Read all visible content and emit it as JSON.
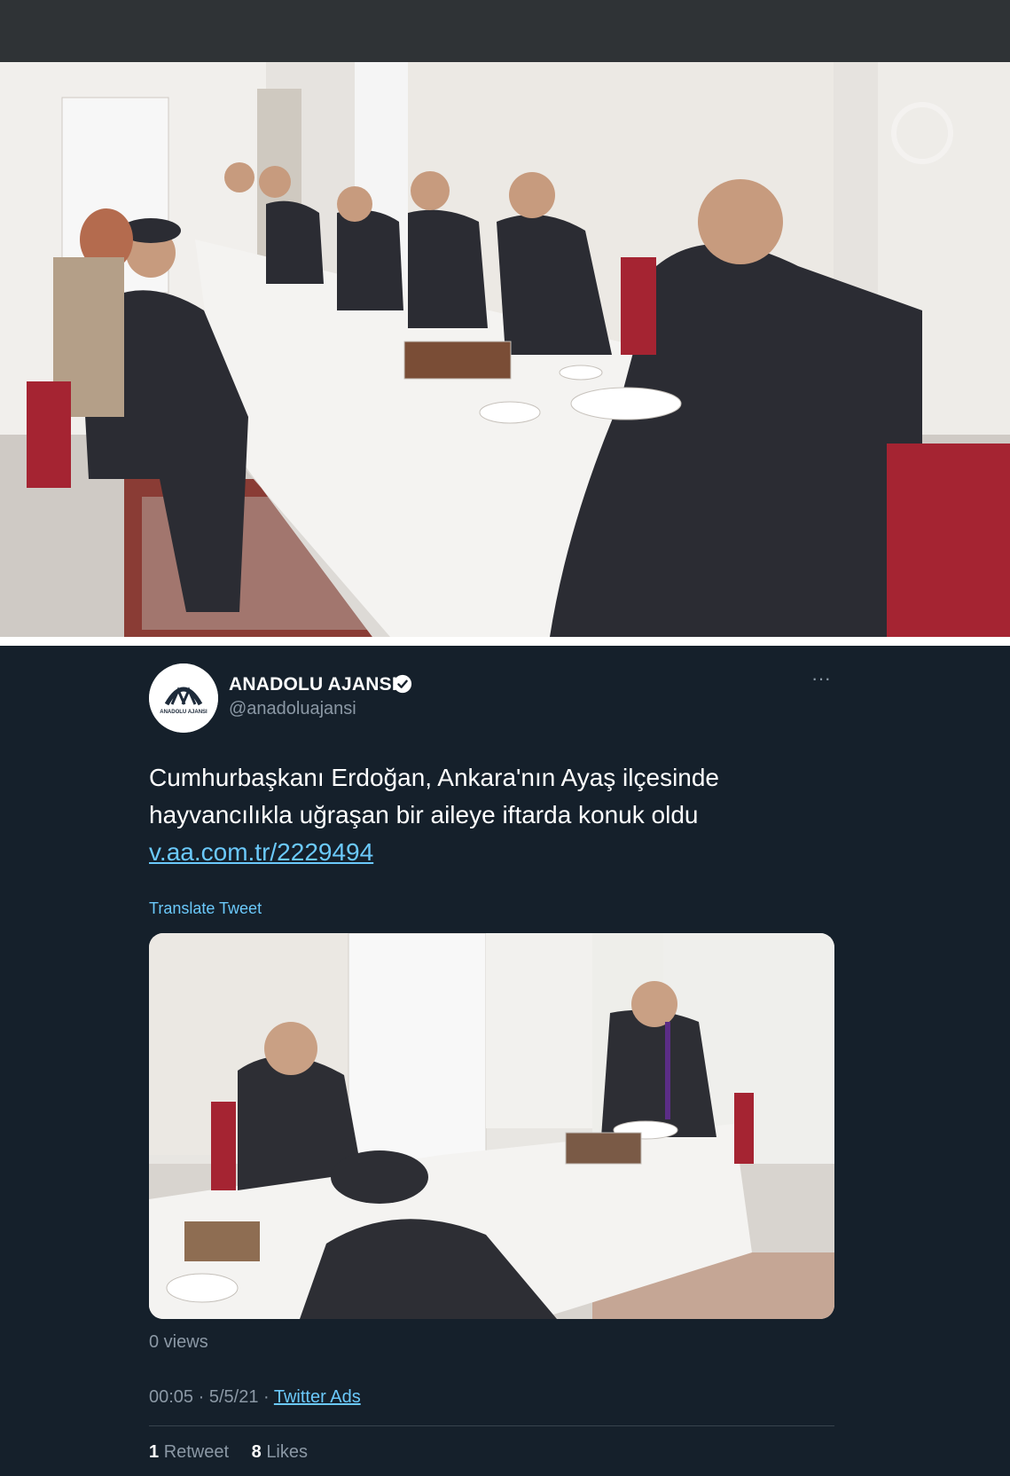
{
  "tweet": {
    "author_name": "ANADOLU AJANSI",
    "handle": "@anadoluajansi",
    "avatar_text": "ANADOLU AJANSI",
    "text_main": "Cumhurbaşkanı Erdoğan, Ankara'nın Ayaş ilçesinde hayvancılıkla uğraşan bir aileye iftarda konuk oldu ",
    "link_text": "v.aa.com.tr/2229494",
    "translate_label": "Translate Tweet",
    "views": "0 views",
    "time": "00:05",
    "date": "5/5/21",
    "source": "Twitter Ads",
    "retweets_count": "1",
    "retweets_label": "Retweet",
    "likes_count": "8",
    "likes_label": "Likes",
    "more_label": "···"
  },
  "colors": {
    "background": "#15202b",
    "link": "#6bc9fb",
    "secondary_text": "#8b98a5",
    "top_bar": "#2f3336"
  },
  "icons": [
    "verified-badge-icon",
    "more-options-icon"
  ]
}
